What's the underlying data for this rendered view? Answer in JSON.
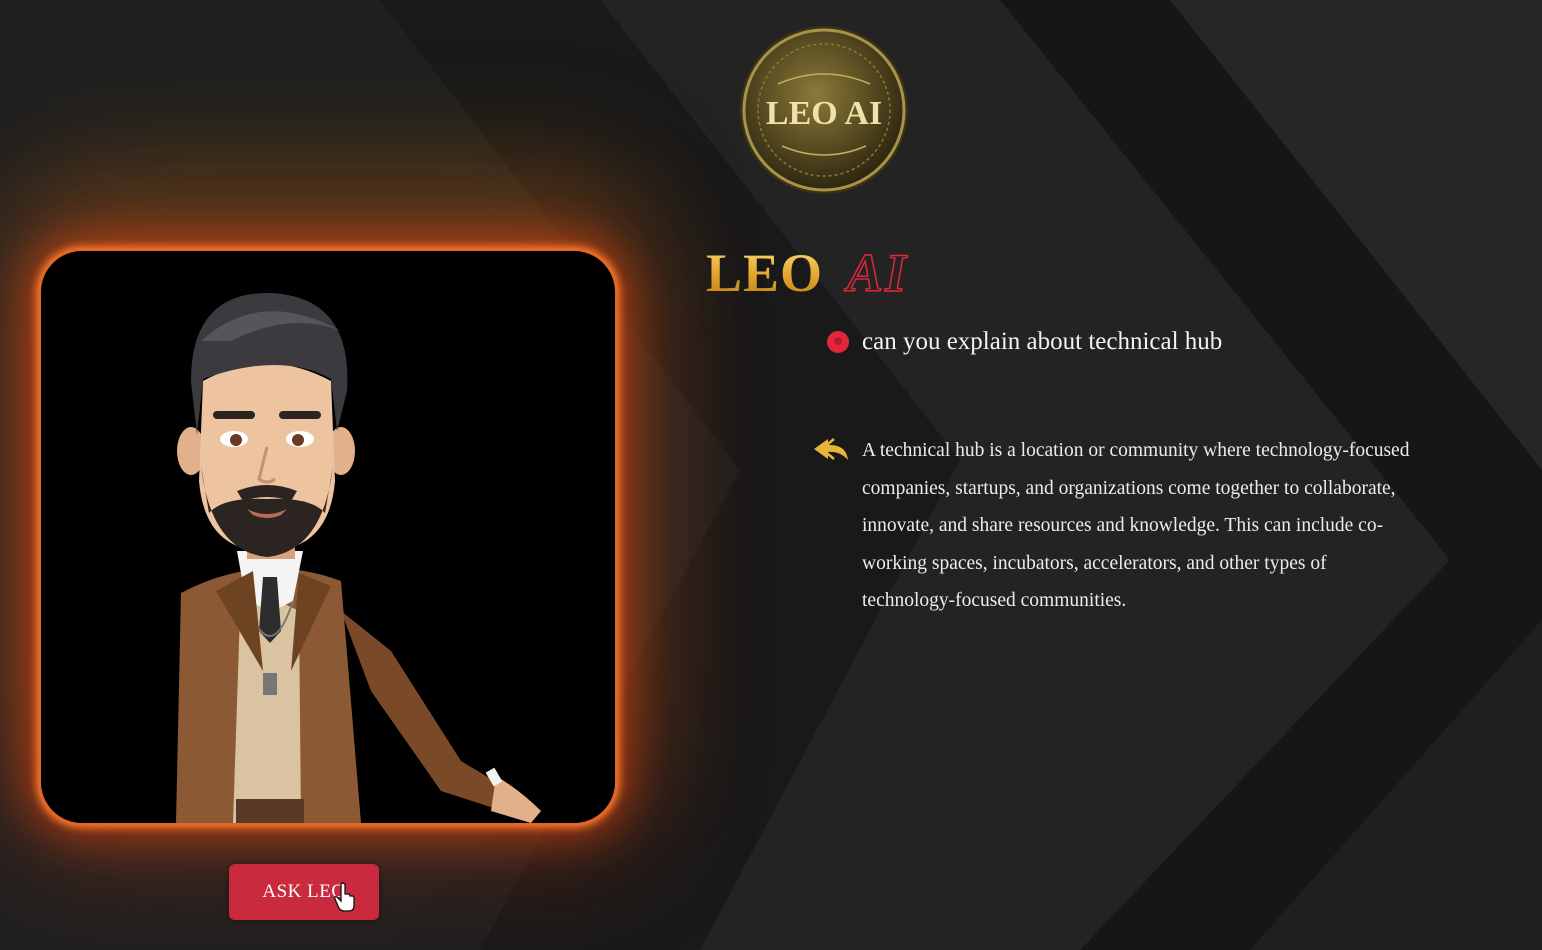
{
  "logo": {
    "coin_text": "LEO AI"
  },
  "brand": {
    "title_part1": "LEO",
    "title_part2": "AI"
  },
  "chat": {
    "question": "can you explain about technical hub",
    "answer": "A technical hub is a location or community where technology-focused companies, startups, and organizations come together to collaborate, innovate, and share resources and knowledge. This can include co-working spaces, incubators, accelerators, and other types of technology-focused communities."
  },
  "controls": {
    "ask_button_label": "ASK LEO"
  },
  "colors": {
    "background": "#1e1e1e",
    "accent_red": "#c92a3e",
    "accent_gold": "#e8b53a",
    "glow_orange": "#e0672a",
    "question_icon": "#e0283a",
    "reply_icon": "#e8b53a"
  },
  "icons": {
    "question": "red-dot-icon",
    "reply": "reply-arrow-icon",
    "cursor": "hand-pointer-icon"
  }
}
